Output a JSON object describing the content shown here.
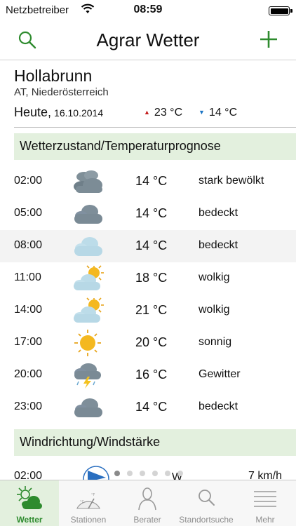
{
  "status_bar": {
    "carrier": "Netzbetreiber",
    "time": "08:59"
  },
  "navbar": {
    "title": "Agrar Wetter"
  },
  "location": {
    "name": "Hollabrunn",
    "region": "AT, Niederösterreich",
    "today_label": "Heute,",
    "date": "16.10.2014",
    "temp_max": "23 °C",
    "temp_min": "14 °C"
  },
  "sections": {
    "forecast": "Wetterzustand/Temperaturprognose",
    "wind": "Windrichtung/Windstärke"
  },
  "forecast": [
    {
      "time": "02:00",
      "icon": "heavy-clouds-icon",
      "temp": "14 °C",
      "condition": "stark bewölkt"
    },
    {
      "time": "05:00",
      "icon": "overcast-cloud-icon",
      "temp": "14 °C",
      "condition": "bedeckt"
    },
    {
      "time": "08:00",
      "icon": "light-cloud-icon",
      "temp": "14 °C",
      "condition": "bedeckt"
    },
    {
      "time": "11:00",
      "icon": "partly-cloudy-icon",
      "temp": "18 °C",
      "condition": "wolkig"
    },
    {
      "time": "14:00",
      "icon": "partly-cloudy-icon",
      "temp": "21 °C",
      "condition": "wolkig"
    },
    {
      "time": "17:00",
      "icon": "sun-icon",
      "temp": "20 °C",
      "condition": "sonnig"
    },
    {
      "time": "20:00",
      "icon": "thunderstorm-icon",
      "temp": "16 °C",
      "condition": "Gewitter"
    },
    {
      "time": "23:00",
      "icon": "overcast-cloud-icon",
      "temp": "14 °C",
      "condition": "bedeckt"
    }
  ],
  "wind": {
    "time": "02:00",
    "direction": "W",
    "speed": "7  km/h"
  },
  "page_indicator": {
    "count": 6,
    "active": 0
  },
  "tabs": [
    {
      "label": "Wetter",
      "icon": "weather-icon",
      "selected": true
    },
    {
      "label": "Stationen",
      "icon": "stations-icon",
      "selected": false
    },
    {
      "label": "Berater",
      "icon": "advisor-icon",
      "selected": false
    },
    {
      "label": "Standortsuche",
      "icon": "location-search-icon",
      "selected": false
    },
    {
      "label": "Mehr",
      "icon": "more-icon",
      "selected": false
    }
  ],
  "colors": {
    "accent": "#2e8b2e",
    "section_bg": "#e3f0de",
    "temp_up": "#c41e1e",
    "temp_down": "#1a74c4"
  }
}
